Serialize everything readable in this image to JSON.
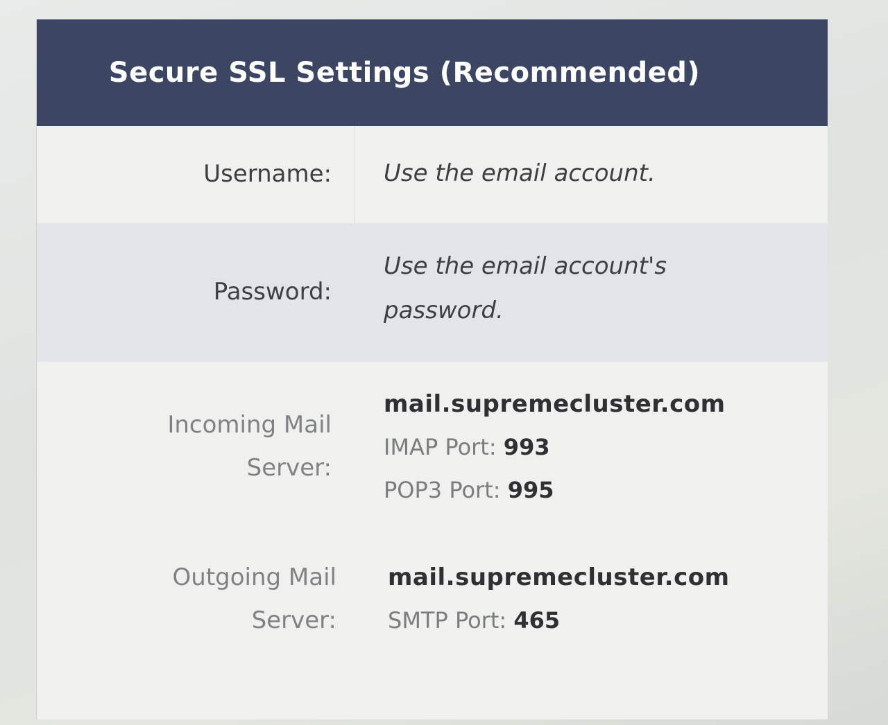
{
  "header": {
    "title": "Secure SSL Settings (Recommended)"
  },
  "rows": {
    "username": {
      "label": "Username:",
      "value": "Use the email account."
    },
    "password": {
      "label": "Password:",
      "value_line1": "Use the email account's",
      "value_line2": "password."
    },
    "incoming": {
      "label_line1": "Incoming Mail",
      "label_line2": "Server:",
      "host": "mail.supremecluster.com",
      "imap_label": "IMAP Port:",
      "imap_port": "993",
      "pop3_label": "POP3 Port:",
      "pop3_port": "995"
    },
    "outgoing": {
      "label_line1": "Outgoing Mail",
      "label_line2": "Server:",
      "host": "mail.supremecluster.com",
      "smtp_label": "SMTP Port:",
      "smtp_port": "465"
    }
  },
  "colors": {
    "header_bg": "#3c4562",
    "shaded_row": "#e1e5ea"
  }
}
